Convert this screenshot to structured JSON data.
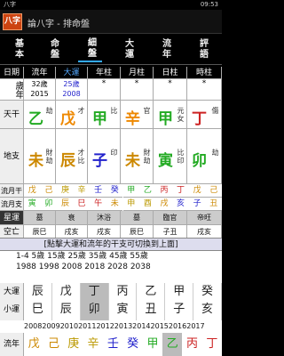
{
  "status": {
    "left": "八字",
    "right": "09:53"
  },
  "app": {
    "logo": "八字",
    "title": "論八字 - 排命盤"
  },
  "tabs": [
    "基本",
    "命盤",
    "細盤",
    "大運",
    "流年",
    "評語"
  ],
  "active_tab": 2,
  "headers": [
    "日期",
    "流年",
    "大運",
    "年柱",
    "月柱",
    "日柱",
    "時柱"
  ],
  "age_row": {
    "label": "歲年",
    "liunian": [
      "32歲",
      "2015"
    ],
    "dayun": [
      "25歲",
      "2008"
    ],
    "stars": [
      "*",
      "*",
      "*",
      "*"
    ]
  },
  "tiangan": {
    "label": "天干",
    "cells": [
      {
        "char": "乙",
        "side": "劫",
        "color": "#2a2"
      },
      {
        "char": "戊",
        "side": "才",
        "color": "#e80"
      },
      {
        "char": "甲",
        "side": "比",
        "color": "#2a2"
      },
      {
        "char": "辛",
        "side": "官",
        "color": "#e80"
      },
      {
        "char": "甲",
        "side": "元女",
        "color": "#2a2"
      },
      {
        "char": "丁",
        "side": "傷",
        "color": "#c22"
      }
    ]
  },
  "dizhi": {
    "label": "地支",
    "cells": [
      {
        "char": "未",
        "side": "財劫",
        "color": "#c80"
      },
      {
        "char": "辰",
        "side": "才比",
        "color": "#c80"
      },
      {
        "char": "子",
        "side": "印",
        "color": "#22c"
      },
      {
        "char": "未",
        "side": "財劫",
        "color": "#c80"
      },
      {
        "char": "寅",
        "side": "比印",
        "color": "#2a2"
      },
      {
        "char": "卯",
        "side": "劫",
        "color": "#2a2"
      }
    ]
  },
  "liuyue_gan": {
    "label": "流月干",
    "items": [
      "戊",
      "己",
      "庚",
      "辛",
      "壬",
      "癸",
      "甲",
      "乙",
      "丙",
      "丁",
      "戊",
      "己"
    ]
  },
  "liuyue_zhi": {
    "label": "流月支",
    "items": [
      "寅",
      "卯",
      "辰",
      "巳",
      "午",
      "未",
      "申",
      "酉",
      "戌",
      "亥",
      "子",
      "丑"
    ]
  },
  "xingyun": {
    "label": "星運",
    "items": [
      "墓",
      "衰",
      "沐浴",
      "墓",
      "臨官",
      "帝旺"
    ]
  },
  "kongwang": {
    "label": "空亡",
    "items": [
      "辰巳",
      "戌亥",
      "戌亥",
      "辰巳",
      "子丑",
      "戌亥"
    ]
  },
  "note": "[點擊大運和流年的干支可切換到上面]",
  "ages": {
    "line1": [
      "1-4",
      "5歲",
      "15歲",
      "25歲",
      "35歲",
      "45歲",
      "55歲"
    ],
    "line2": [
      "1988",
      "1998",
      "2008",
      "2018",
      "2028",
      "2038"
    ]
  },
  "dayun": {
    "label": [
      "大運",
      "小運"
    ],
    "gan": [
      "辰",
      "戊",
      "丁",
      "丙",
      "乙",
      "甲",
      "癸"
    ],
    "zhi": [
      "巳",
      "辰",
      "卯",
      "寅",
      "丑",
      "子",
      "亥"
    ]
  },
  "years": "2008200920102011201220132014201520162017",
  "liunian": {
    "label": "流年",
    "gan": [
      "戊",
      "己",
      "庚",
      "辛",
      "壬",
      "癸",
      "甲",
      "乙",
      "丙",
      "丁"
    ]
  }
}
